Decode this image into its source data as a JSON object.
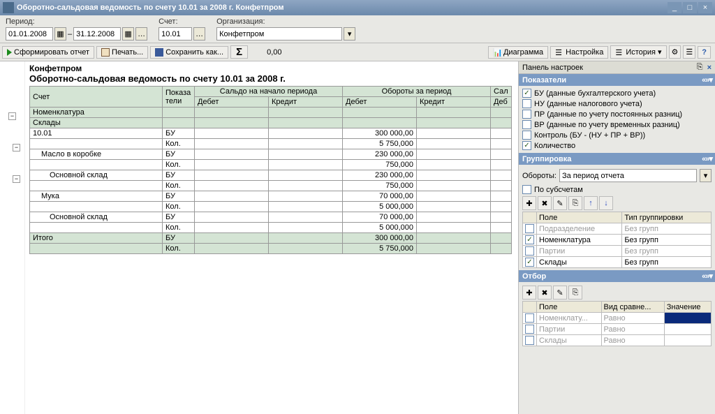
{
  "title": "Оборотно-сальдовая ведомость по счету 10.01 за 2008 г. Конфетпром",
  "toolbar1": {
    "period_label": "Период:",
    "date_from": "01.01.2008",
    "date_to": "31.12.2008",
    "account_label": "Счет:",
    "account": "10.01",
    "org_label": "Организация:",
    "org": "Конфетпром"
  },
  "toolbar2": {
    "run": "Сформировать отчет",
    "print": "Печать...",
    "save": "Сохранить как...",
    "total": "0,00",
    "diagram": "Диаграмма",
    "settings": "Настройка",
    "history": "История"
  },
  "report": {
    "org": "Конфетпром",
    "title": "Оборотно-сальдовая ведомость по счету 10.01 за 2008 г.",
    "headers": {
      "account": "Счет",
      "indic": "Показа\nтели",
      "saldo_start": "Сальдо на начало периода",
      "turnover": "Обороты за период",
      "sal": "Сал",
      "debet": "Дебет",
      "credit": "Кредит",
      "deb": "Деб",
      "nomen": "Номенклатура",
      "sklad": "Склады"
    },
    "rows": [
      {
        "lvl": 0,
        "l": "10.01",
        "i": "БУ",
        "td": "300 000,00"
      },
      {
        "lvl": 0,
        "l": "",
        "i": "Кол.",
        "td": "5 750,000"
      },
      {
        "lvl": 1,
        "l": "Масло в коробке",
        "i": "БУ",
        "td": "230 000,00"
      },
      {
        "lvl": 1,
        "l": "",
        "i": "Кол.",
        "td": "750,000"
      },
      {
        "lvl": 2,
        "l": "Основной склад",
        "i": "БУ",
        "td": "230 000,00"
      },
      {
        "lvl": 2,
        "l": "",
        "i": "Кол.",
        "td": "750,000"
      },
      {
        "lvl": 1,
        "l": "Мука",
        "i": "БУ",
        "td": "70 000,00"
      },
      {
        "lvl": 1,
        "l": "",
        "i": "Кол.",
        "td": "5 000,000"
      },
      {
        "lvl": 2,
        "l": "Основной склад",
        "i": "БУ",
        "td": "70 000,00"
      },
      {
        "lvl": 2,
        "l": "",
        "i": "Кол.",
        "td": "5 000,000"
      }
    ],
    "total_label": "Итого",
    "total_bu": "300 000,00",
    "total_kol": "5 750,000",
    "bu": "БУ",
    "kol": "Кол."
  },
  "side": {
    "header": "Панель настроек",
    "indicators": {
      "title": "Показатели",
      "items": [
        {
          "on": true,
          "label": "БУ (данные бухгалтерского учета)"
        },
        {
          "on": false,
          "label": "НУ (данные налогового учета)"
        },
        {
          "on": false,
          "label": "ПР (данные по учету постоянных разниц)"
        },
        {
          "on": false,
          "label": "ВР (данные по учету временных разниц)"
        },
        {
          "on": false,
          "label": "Контроль (БУ - (НУ + ПР + ВР))"
        },
        {
          "on": true,
          "label": "Количество"
        }
      ]
    },
    "grouping": {
      "title": "Группировка",
      "turnover_label": "Обороты:",
      "turnover_val": "За период отчета",
      "subaccounts": "По субсчетам",
      "col_field": "Поле",
      "col_type": "Тип группировки",
      "rows": [
        {
          "on": false,
          "field": "Подразделение",
          "type": "Без групп",
          "dim": true
        },
        {
          "on": true,
          "field": "Номенклатура",
          "type": "Без групп",
          "dim": false
        },
        {
          "on": false,
          "field": "Партии",
          "type": "Без групп",
          "dim": true
        },
        {
          "on": true,
          "field": "Склады",
          "type": "Без групп",
          "dim": false
        }
      ]
    },
    "filter": {
      "title": "Отбор",
      "col_field": "Поле",
      "col_cmp": "Вид сравне...",
      "col_val": "Значение",
      "rows": [
        {
          "field": "Номенклату...",
          "cmp": "Равно",
          "sel": true
        },
        {
          "field": "Партии",
          "cmp": "Равно",
          "sel": false
        },
        {
          "field": "Склады",
          "cmp": "Равно",
          "sel": false
        }
      ]
    }
  }
}
